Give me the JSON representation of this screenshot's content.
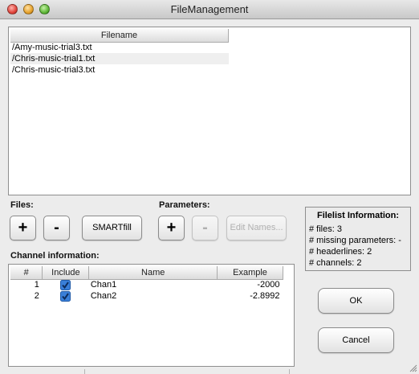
{
  "window": {
    "title": "FileManagement"
  },
  "file_list": {
    "column_header": "Filename",
    "rows": [
      "/Amy-music-trial3.txt",
      "/Chris-music-trial1.txt",
      "/Chris-music-trial3.txt"
    ]
  },
  "files_section": {
    "label": "Files:",
    "add_label": "+",
    "remove_label": "-",
    "smartfill_label": "SMARTfill"
  },
  "parameters_section": {
    "label": "Parameters:",
    "add_label": "+",
    "remove_label": "-",
    "edit_names_label": "Edit Names..."
  },
  "filelist_info": {
    "header": "Filelist Information:",
    "lines": [
      "# files:  3",
      "# missing parameters:  -",
      "# headerlines:  2",
      "# channels:  2"
    ]
  },
  "channel_info": {
    "label": "Channel information:",
    "headers": [
      "#",
      "Include",
      "Name",
      "Example"
    ],
    "rows": [
      {
        "num": "1",
        "include": true,
        "name": "Chan1",
        "example": "-2000"
      },
      {
        "num": "2",
        "include": true,
        "name": "Chan2",
        "example": "-2.8992"
      }
    ]
  },
  "dialog_buttons": {
    "ok_label": "OK",
    "cancel_label": "Cancel"
  },
  "colors": {
    "checkbox_blue": "#3a7fd8"
  }
}
